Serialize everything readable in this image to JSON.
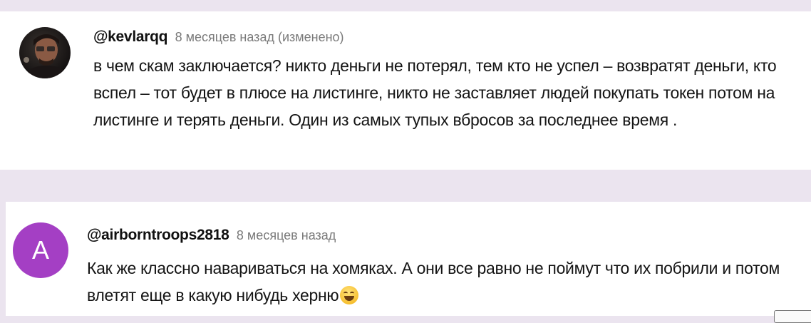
{
  "comments": [
    {
      "handle": "@kevlarqq",
      "meta": "8 месяцев назад (изменено)",
      "text": "в чем скам заключается? никто деньги не потерял, тем кто не успел – возвратят деньги, кто вспел – тот будет в плюсе на листинге, никто не заставляет людей покупать токен потом на листинге и терять деньги. Один из самых тупых вбросов за последнее время ."
    },
    {
      "handle": "@airborntroops2818",
      "meta": "8 месяцев назад",
      "avatar_letter": "A",
      "avatar_color": "#a43fc4",
      "text": "Как же классно навариваться на хомяках. А они все равно не поймут что их побрили и потом влетят еще в какую нибудь херню",
      "emoji": "grinning-face-emoji"
    }
  ]
}
